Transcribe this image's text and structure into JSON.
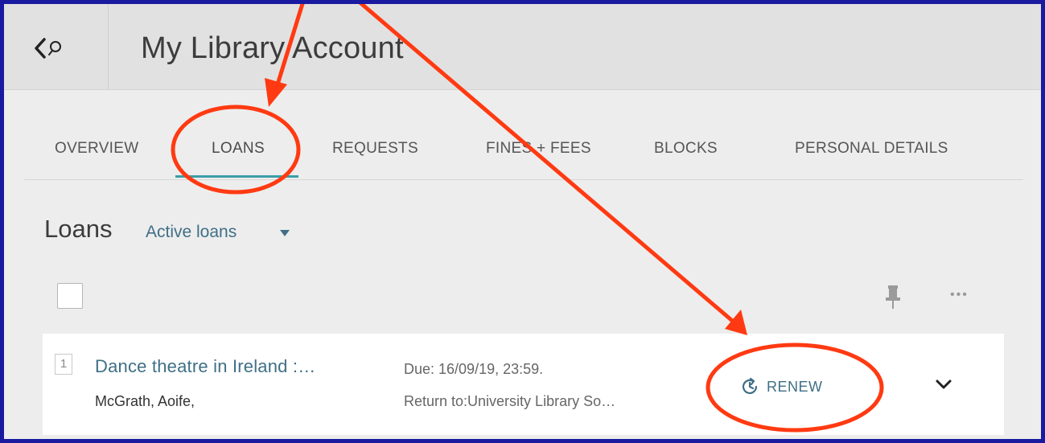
{
  "header": {
    "back_label": "",
    "title": "My Library Account"
  },
  "tabs": [
    {
      "label": "OVERVIEW"
    },
    {
      "label": "LOANS",
      "active": true
    },
    {
      "label": "REQUESTS"
    },
    {
      "label": "FINES + FEES"
    },
    {
      "label": "BLOCKS"
    },
    {
      "label": "PERSONAL DETAILS"
    }
  ],
  "loans": {
    "heading": "Loans",
    "filter": "Active loans",
    "items": [
      {
        "number": "1",
        "title": "Dance theatre in Ireland :…",
        "author": "McGrath, Aoife,",
        "due": "Due: 16/09/19, 23:59.",
        "return_to": "Return to:University Library So…",
        "renew_label": "RENEW"
      }
    ]
  },
  "icons": {
    "back": "back-search-icon",
    "pin": "pin-icon",
    "more": "more-icon",
    "renew": "renew-clock-icon",
    "expand": "chevron-down-icon"
  },
  "colors": {
    "accent": "#3f6f86",
    "tab_underline": "#3a9ea8",
    "annotation": "#ff3a12",
    "frame_border": "#1a1aa0"
  }
}
